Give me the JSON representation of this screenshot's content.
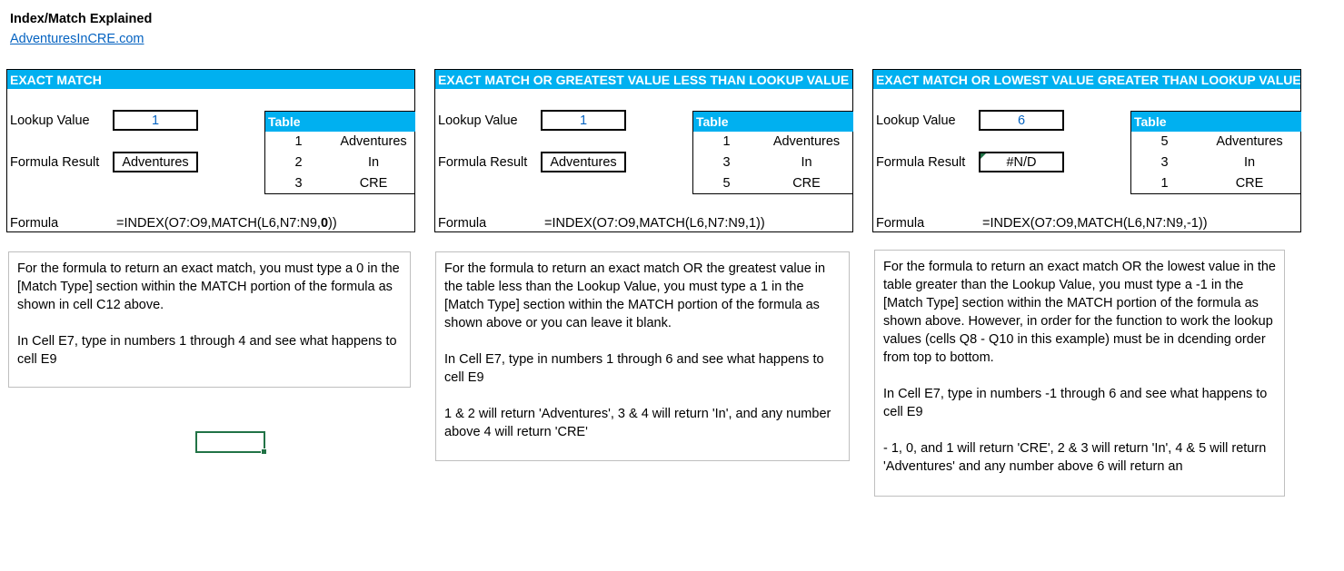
{
  "header": {
    "title": "Index/Match Explained",
    "link": "AdventuresInCRE.com"
  },
  "theme": {
    "accent": "#00b0f0",
    "link": "#0563c1",
    "selection": "#217346"
  },
  "panels": [
    {
      "title": "EXACT MATCH",
      "lookup_label": "Lookup Value",
      "lookup_value": "1",
      "result_label": "Formula Result",
      "result_value": "Adventures",
      "table_header": "Table",
      "table_rows": [
        {
          "num": "1",
          "text": "Adventures"
        },
        {
          "num": "2",
          "text": "In"
        },
        {
          "num": "3",
          "text": "CRE"
        }
      ],
      "formula_label": "Formula",
      "formula_prefix": "=INDEX(O7:O9,MATCH(L6,N7:N9,",
      "formula_match_type": "0",
      "formula_suffix": "))",
      "note_paragraphs": [
        "For the formula to return an exact match, you must type a 0 in the [Match Type] section within the MATCH portion of the formula as shown in cell C12 above.",
        "In Cell E7, type in numbers 1 through 4 and see what happens to cell E9"
      ]
    },
    {
      "title": "EXACT MATCH OR GREATEST VALUE LESS THAN LOOKUP VALUE",
      "lookup_label": "Lookup Value",
      "lookup_value": "1",
      "result_label": "Formula Result",
      "result_value": "Adventures",
      "table_header": "Table",
      "table_rows": [
        {
          "num": "1",
          "text": "Adventures"
        },
        {
          "num": "3",
          "text": "In"
        },
        {
          "num": "5",
          "text": "CRE"
        }
      ],
      "formula_label": "Formula",
      "formula_prefix": "=INDEX(O7:O9,MATCH(L6,N7:N9,",
      "formula_match_type": "1",
      "formula_suffix": "))",
      "note_paragraphs": [
        "For the formula to return an exact match OR the greatest value in the table less than the Lookup Value, you must type a 1 in the [Match Type] section within the MATCH portion of the formula as shown above or you can leave it blank.",
        "In Cell E7, type in numbers 1 through 6 and see what happens to cell E9",
        "1 & 2 will return 'Adventures', 3 & 4 will return 'In', and any number above 4 will return 'CRE'"
      ]
    },
    {
      "title": "EXACT MATCH OR LOWEST VALUE GREATER THAN LOOKUP VALUE",
      "lookup_label": "Lookup Value",
      "lookup_value": "6",
      "result_label": "Formula Result",
      "result_value": "#N/D",
      "table_header": "Table",
      "table_rows": [
        {
          "num": "5",
          "text": "Adventures"
        },
        {
          "num": "3",
          "text": "In"
        },
        {
          "num": "1",
          "text": "CRE"
        }
      ],
      "formula_label": "Formula",
      "formula_prefix": "=INDEX(O7:O9,MATCH(L6,N7:N9,",
      "formula_match_type": "-1",
      "formula_suffix": "))",
      "note_paragraphs": [
        "For the formula to return an exact match OR the lowest value in the table greater than the Lookup Value, you must type a -1 in the [Match Type] section within the MATCH portion of the formula as shown above. However, in order for the function to work the lookup values (cells Q8 - Q10 in this example) must be in dcending order from top to bottom.",
        "In Cell E7, type in numbers -1 through 6 and see what happens to cell E9",
        "- 1, 0, and 1 will return 'CRE', 2 & 3 will return 'In', 4 & 5 will return 'Adventures' and any number above 6 will return an"
      ]
    }
  ]
}
